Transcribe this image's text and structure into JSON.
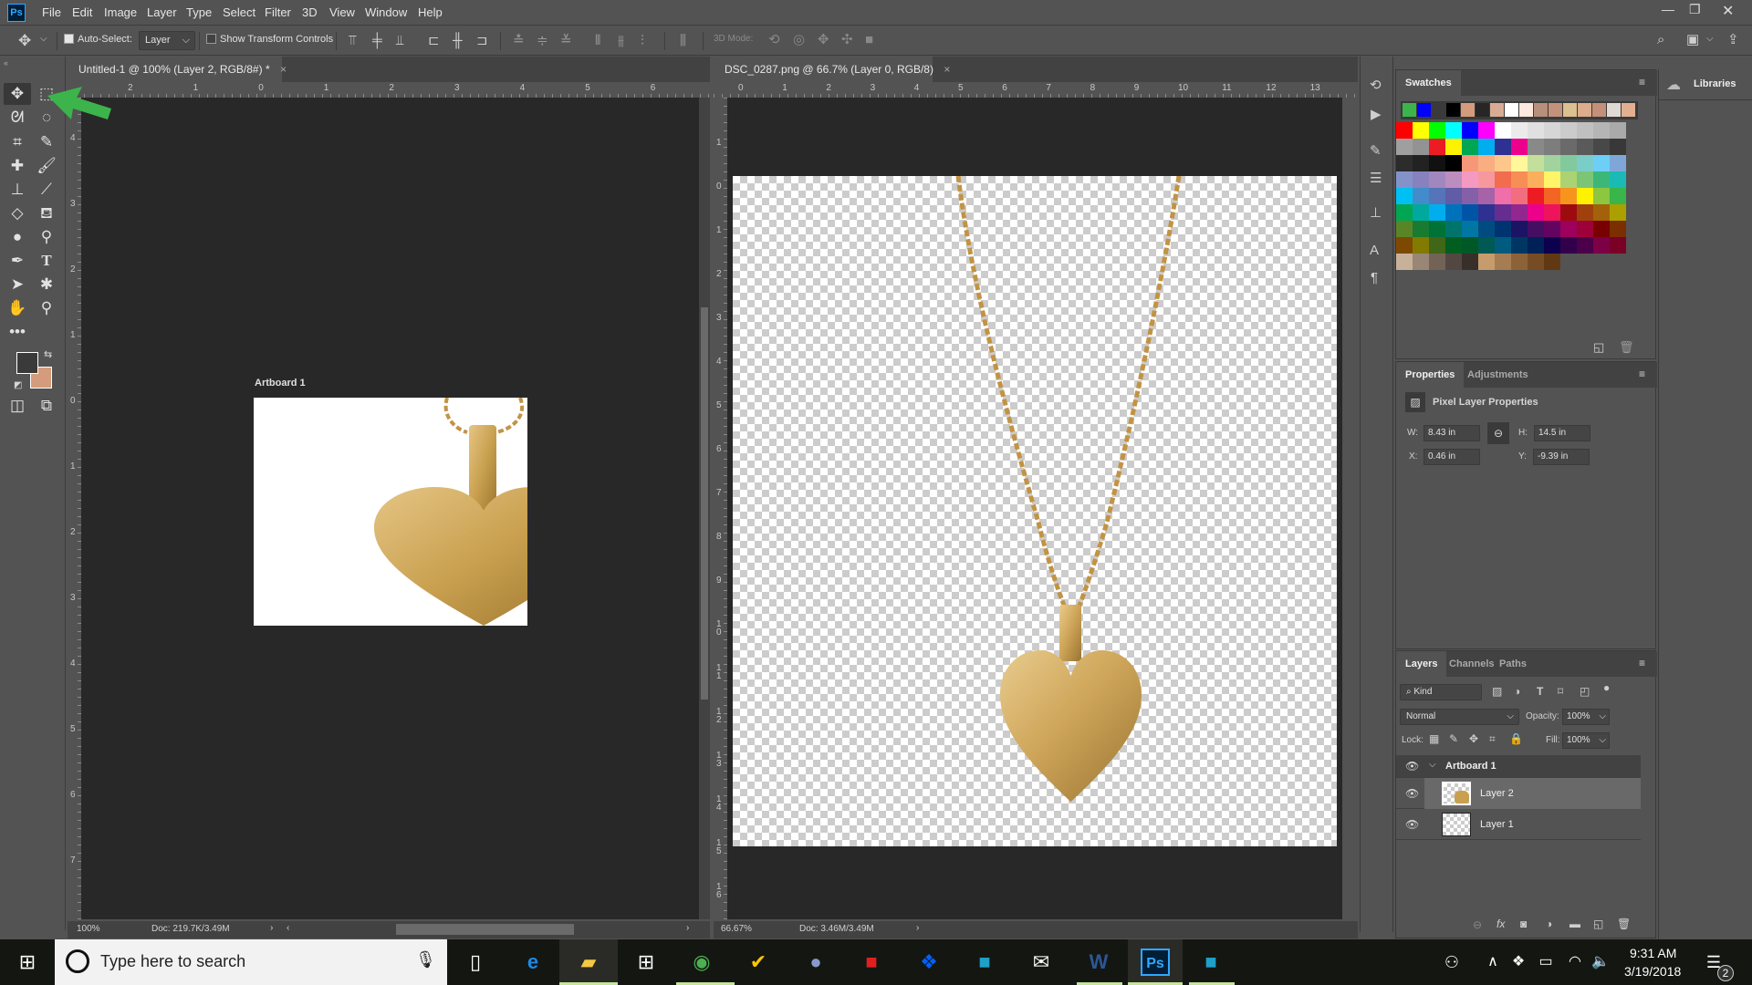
{
  "app": {
    "logo": "Ps"
  },
  "menu": [
    "File",
    "Edit",
    "Image",
    "Layer",
    "Type",
    "Select",
    "Filter",
    "3D",
    "View",
    "Window",
    "Help"
  ],
  "options_bar": {
    "auto_select_label": "Auto-Select:",
    "auto_select_checked": true,
    "auto_select_target": "Layer",
    "show_transform_label": "Show Transform Controls",
    "show_transform_checked": false,
    "mode_3d_label": "3D Mode:"
  },
  "colors": {
    "foreground": "#3a3a3a",
    "background": "#d49c7c",
    "annotation_arrow": "#3cb44b",
    "gold": "#c9a04f"
  },
  "doc1": {
    "tab_title": "Untitled-1 @ 100% (Layer 2, RGB/8#) *",
    "close": "×",
    "ruler_h": [
      "2",
      "1",
      "0",
      "1",
      "2",
      "3",
      "4",
      "5",
      "6"
    ],
    "ruler_v": [
      "4",
      "3",
      "2",
      "1",
      "0",
      "1",
      "2",
      "3",
      "4",
      "5",
      "6",
      "7"
    ],
    "artboard_label": "Artboard 1",
    "zoom": "100%",
    "doc_size": "Doc: 219.7K/3.49M"
  },
  "doc2": {
    "tab_title": "DSC_0287.png @ 66.7% (Layer 0, RGB/8)",
    "close": "×",
    "ruler_h": [
      "0",
      "1",
      "2",
      "3",
      "4",
      "5",
      "6",
      "7",
      "8",
      "9",
      "10",
      "11",
      "12",
      "13"
    ],
    "ruler_v": [
      "1",
      "0",
      "1",
      "2",
      "3",
      "4",
      "5",
      "6",
      "7",
      "8",
      "9",
      "1 0",
      "1 1",
      "1 2",
      "1 3",
      "1 4",
      "1 5",
      "1 6"
    ],
    "zoom": "66.67%",
    "doc_size": "Doc: 3.46M/3.49M"
  },
  "swatches": {
    "title": "Swatches",
    "recent": [
      "#3cb44b",
      "#0000ff",
      "#3a3a3a",
      "#000000",
      "#d49c7c",
      "#262626",
      "#d8ac94",
      "#ffffff",
      "#fde8df",
      "#b78f7a",
      "#c4927a",
      "#dbc090",
      "#ddac8c",
      "#c4907a",
      "#e0d8d2",
      "#e2b090"
    ],
    "grid": [
      [
        "#ff0000",
        "#ffff00",
        "#00ff00",
        "#00ffff",
        "#0000ff",
        "#ff00ff",
        "#ffffff",
        "#ebebeb",
        "#e0e0e0",
        "#d6d6d6",
        "#cbcbcb",
        "#c0c0c0",
        "#b5b5b5",
        "#aaaaaa"
      ],
      [
        "#9f9f9f",
        "#939393",
        "#ed1c24",
        "#fff200",
        "#00a651",
        "#00aeef",
        "#2e3192",
        "#ec008c",
        "#898989",
        "#7d7d7d",
        "#6a6a6a",
        "#5a5a5a",
        "#484848",
        "#383838"
      ],
      [
        "#2c2c2c",
        "#222222",
        "#111111",
        "#000000",
        "#f7977a",
        "#f9ad81",
        "#fdc68a",
        "#fff79a",
        "#c4df9b",
        "#a3d39c",
        "#82ca9d",
        "#7bcdc8",
        "#6dcff6",
        "#7ea7d8"
      ],
      [
        "#8393ca",
        "#8781bd",
        "#a187be",
        "#bc8dbf",
        "#f49ac2",
        "#f6989d",
        "#f26c4f",
        "#f68e56",
        "#fbaf5d",
        "#fff568",
        "#acd373",
        "#7cc576",
        "#3bb878",
        "#1abbb4"
      ],
      [
        "#00bff3",
        "#438ccb",
        "#5574b9",
        "#605ca8",
        "#855fa8",
        "#a763a8",
        "#f06eaa",
        "#f26d7d",
        "#ed1c24",
        "#f26522",
        "#f7941d",
        "#fff200",
        "#8dc63f",
        "#39b54a"
      ],
      [
        "#00a651",
        "#00a99d",
        "#00aeef",
        "#0072bc",
        "#0054a6",
        "#2e3192",
        "#662d91",
        "#92278f",
        "#ec008c",
        "#ed145b",
        "#9e0b0f",
        "#a0410d",
        "#a36209",
        "#aba000"
      ],
      [
        "#598527",
        "#197b30",
        "#007236",
        "#00746b",
        "#0076a3",
        "#004b80",
        "#003471",
        "#1b1464",
        "#440e62",
        "#630460",
        "#9e005d",
        "#9e0039",
        "#790000",
        "#7b2e00"
      ],
      [
        "#7d4900",
        "#827b00",
        "#406618",
        "#005e20",
        "#005826",
        "#005952",
        "#005b7f",
        "#003663",
        "#002157",
        "#0d004c",
        "#32004b",
        "#4b0049",
        "#7b0046",
        "#7a0026"
      ],
      [
        "#c7b299",
        "#998675",
        "#736357",
        "#534741",
        "#37302a",
        "#c69c6d",
        "#a67c52",
        "#8c6239",
        "#754c24",
        "#603913"
      ]
    ]
  },
  "libraries": {
    "title": "Libraries"
  },
  "properties": {
    "tabs": [
      "Properties",
      "Adjustments"
    ],
    "heading": "Pixel Layer Properties",
    "w_label": "W:",
    "w": "8.43 in",
    "h_label": "H:",
    "h": "14.5 in",
    "x_label": "X:",
    "x": "0.46 in",
    "y_label": "Y:",
    "y": "-9.39 in"
  },
  "layers": {
    "tabs": [
      "Layers",
      "Channels",
      "Paths"
    ],
    "filter": "Kind",
    "blend_mode": "Normal",
    "opacity_label": "Opacity:",
    "opacity": "100%",
    "lock_label": "Lock:",
    "fill_label": "Fill:",
    "fill": "100%",
    "items": [
      {
        "name": "Artboard 1",
        "type": "artboard",
        "visible": true
      },
      {
        "name": "Layer 2",
        "type": "pixel",
        "visible": true,
        "selected": true
      },
      {
        "name": "Layer 1",
        "type": "pixel",
        "visible": true
      }
    ]
  },
  "taskbar": {
    "search_placeholder": "Type here to search",
    "time": "9:31 AM",
    "date": "3/19/2018",
    "notifications": "2",
    "apps": [
      "task-view",
      "edge",
      "file-explorer",
      "store",
      "chrome",
      "norton",
      "sphere-app",
      "creative-cloud",
      "dropbox",
      "app",
      "mail",
      "word",
      "photoshop",
      "app-2"
    ]
  }
}
